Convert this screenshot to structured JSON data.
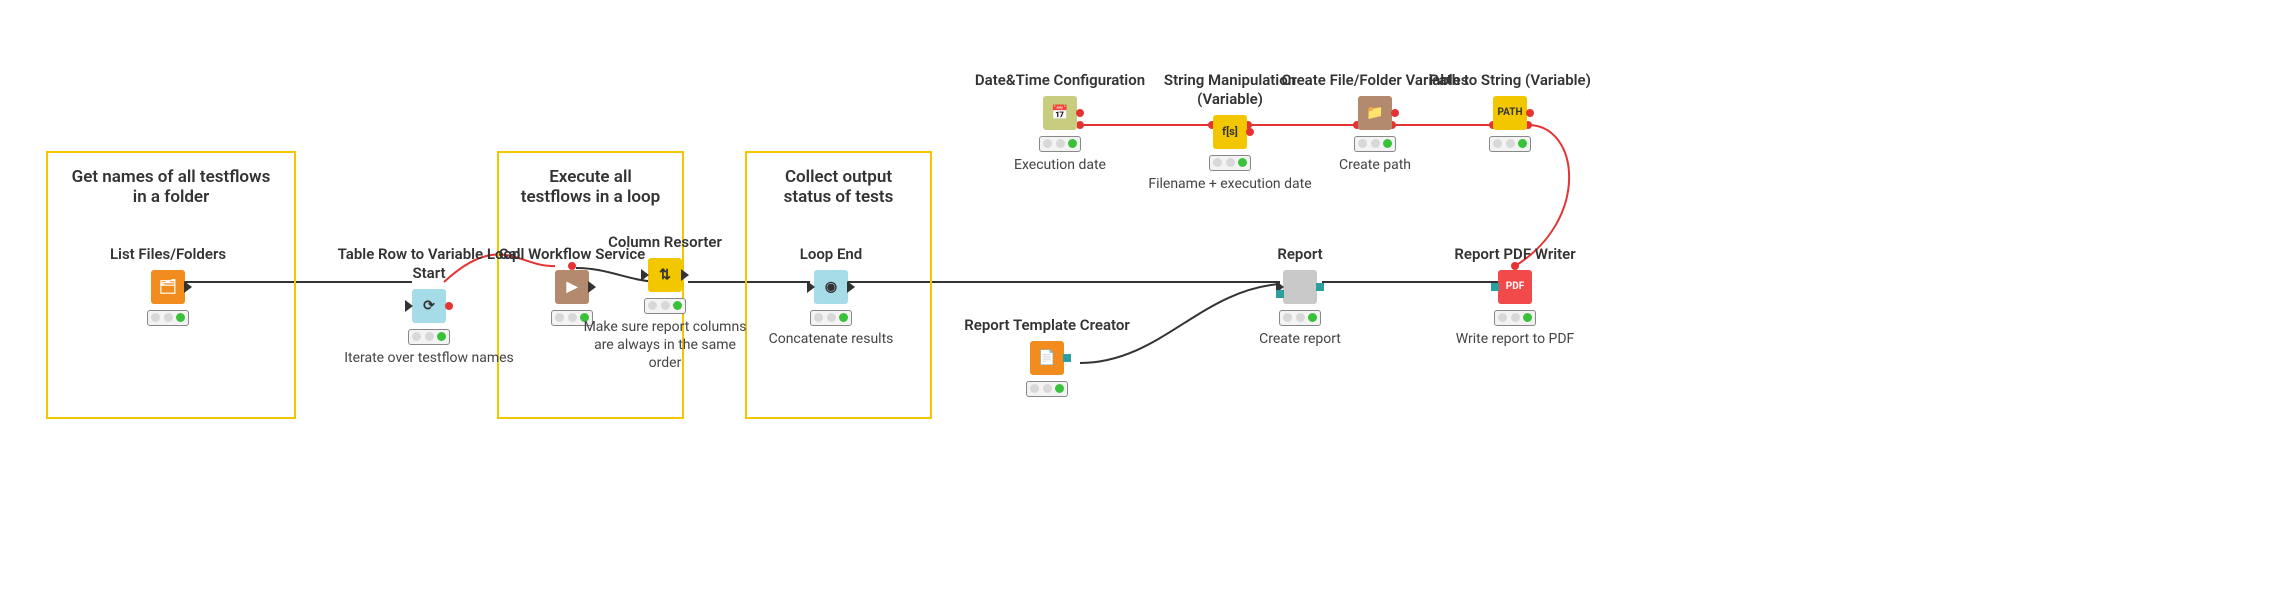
{
  "annotations": {
    "a1": {
      "title": "Get names of all testflows in a folder"
    },
    "a2": {
      "title": "Execute all testflows in a loop"
    },
    "a3": {
      "title": "Collect output status of tests"
    }
  },
  "nodes": {
    "list_files": {
      "title": "List Files/Folders",
      "desc": "",
      "color": "#f28c1e"
    },
    "loop_start": {
      "title": "Table Row to Variable Loop Start",
      "desc": "Iterate over testflow names",
      "color": "#8fd3e8"
    },
    "call_wf": {
      "title": "Call Workflow Service",
      "desc": "",
      "color": "#b38a6d"
    },
    "col_resort": {
      "title": "Column Resorter",
      "desc": "Make sure report columns are always in the same order",
      "color": "#f2c700"
    },
    "loop_end": {
      "title": "Loop End",
      "desc": "Concatenate results",
      "color": "#8fd3e8"
    },
    "datetime": {
      "title": "Date&Time Configuration",
      "desc": "Execution date",
      "color": "#b9bf6e"
    },
    "strmanip": {
      "title": "String Manipulation (Variable)",
      "desc": "Filename + execution date",
      "color": "#f2c700"
    },
    "createpath": {
      "title": "Create File/Folder Variables",
      "desc": "Create path",
      "color": "#b38a6d"
    },
    "path2str": {
      "title": "Path to String (Variable)",
      "desc": "",
      "color": "#f2c700"
    },
    "tmpl_creator": {
      "title": "Report Template Creator",
      "desc": "",
      "color": "#f28c1e"
    },
    "report": {
      "title": "Report",
      "desc": "Create report",
      "color": "#c3c3c3"
    },
    "pdf_writer": {
      "title": "Report PDF Writer",
      "desc": "Write report to PDF",
      "color": "#f24a4a"
    }
  }
}
